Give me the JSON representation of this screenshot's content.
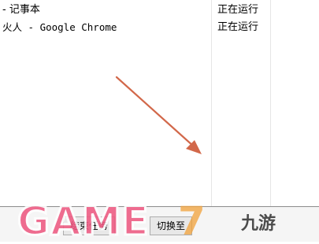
{
  "processes": [
    {
      "name": "- 记事本",
      "status": "正在运行"
    },
    {
      "name": "火人 - Google Chrome",
      "status": "正在运行"
    }
  ],
  "bottom_buttons": [
    "结束任务",
    "切换至"
  ],
  "watermark": {
    "game_text": "GAME",
    "seven_text": "7",
    "logo_text": "九游"
  },
  "colors": {
    "arrow": "#d2684a",
    "watermark_pink": "#ee5a82",
    "watermark_orange": "#f2a23a"
  }
}
